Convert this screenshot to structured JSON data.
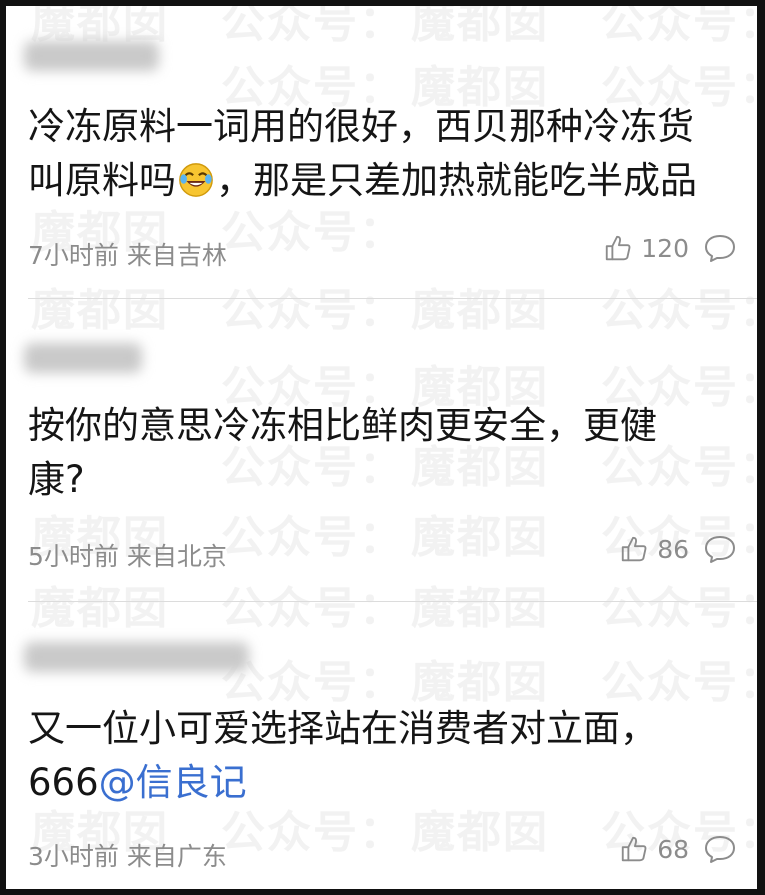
{
  "watermark": {
    "tag_text": "公众号：",
    "name_text": "魔都囡"
  },
  "comments": [
    {
      "content": "冷冻原料一词用的很好，西贝那种冷冻货\n叫原料吗",
      "content_tail": "，那是只差加热就能吃半成品",
      "time": "7小时前",
      "location": "来自吉林",
      "likes": "120"
    },
    {
      "content": "按你的意思冷冻相比鲜肉更安全，更健\n康?",
      "time": "5小时前",
      "location": "来自北京",
      "likes": "86"
    },
    {
      "content": "又一位小可爱选择站在消费者对立面，\n666",
      "mention": "@信良记",
      "time": "3小时前",
      "location": "来自广东",
      "likes": "68"
    }
  ],
  "icons": {
    "emoji": "laughing-tears-emoji",
    "like": "thumbs-up-icon",
    "reply": "comment-bubble-icon"
  },
  "colors": {
    "text": "#151515",
    "meta": "#8c8c8c",
    "mention": "#3a6fd0",
    "divider": "#dcdcdc",
    "frame": "#111111"
  }
}
